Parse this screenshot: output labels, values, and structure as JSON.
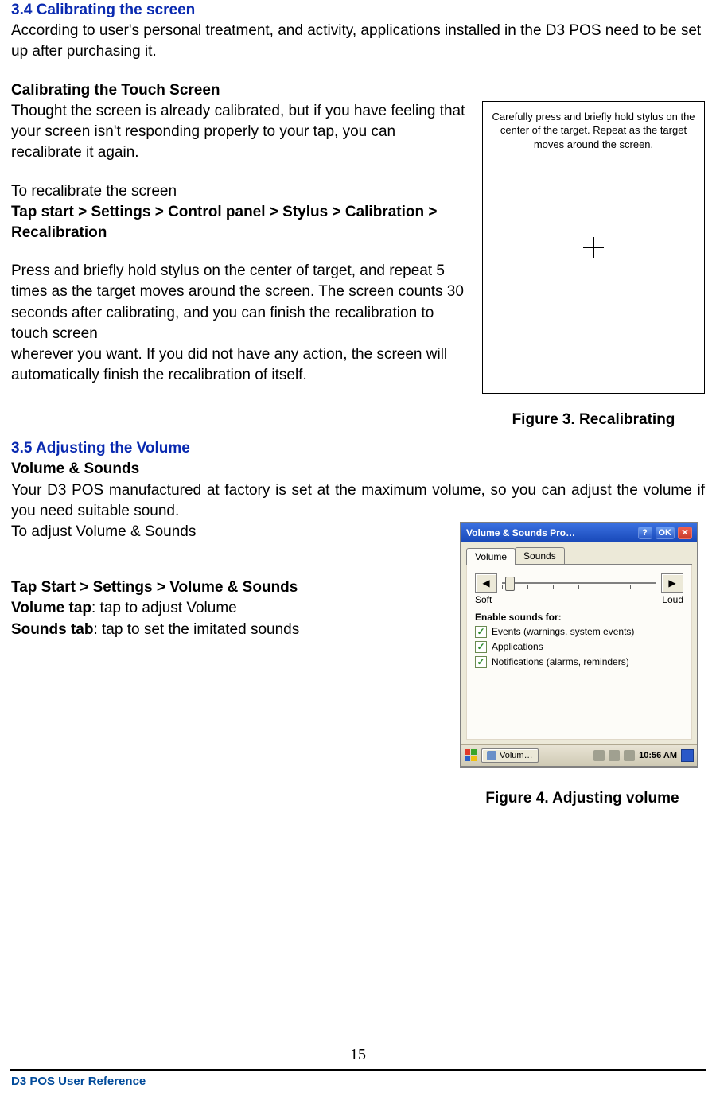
{
  "h34": "3.4 Calibrating the screen",
  "p34": "According to user's personal treatment, and activity, applications installed in the D3 POS need to be set up after purchasing it.",
  "hCal": "Calibrating the Touch Screen",
  "pCal1": "Thought the screen is already calibrated, but if you have feeling that your screen isn't responding properly to your tap, you can recalibrate it again.",
  "pCal2": "To recalibrate the screen",
  "navCal": "Tap start > Settings > Control panel > Stylus > Calibration > Recalibration",
  "pCal3a": "Press and briefly hold stylus on the center of target, and repeat 5 times as the target moves around the screen. The screen counts 30 seconds after calibrating, and you can finish the recalibration to touch screen",
  "pCal3b": "wherever you want. If you did not have any action, the screen will automatically finish the recalibration of itself.",
  "fig3_text": "Carefully press and briefly hold stylus on the center of the target. Repeat as the target moves around the screen.",
  "fig3_cap": "Figure 3. Recalibrating",
  "h35": "3.5 Adjusting the Volume",
  "hVol": "Volume & Sounds",
  "pVol1": "Your D3 POS manufactured at factory is set at the maximum volume, so you can adjust the volume if you need suitable sound.",
  "pVol2": "To adjust Volume & Sounds",
  "navVol": "Tap Start > Settings > Volume & Sounds",
  "volTapLabel": "Volume tap",
  "volTapDesc": ": tap to adjust Volume",
  "sndTabLabel": "Sounds tab",
  "sndTabDesc": ": tap to set the imitated sounds",
  "vs": {
    "title": "Volume & Sounds Pro…",
    "help": "?",
    "ok": "OK",
    "close": "✕",
    "tab_volume": "Volume",
    "tab_sounds": "Sounds",
    "soft": "Soft",
    "loud": "Loud",
    "enable": "Enable sounds for:",
    "chk1": "Events (warnings, system events)",
    "chk2": "Applications",
    "chk3": "Notifications (alarms, reminders)",
    "task_app": "Volum…",
    "clock": "10:56 AM"
  },
  "fig4_cap": "Figure 4. Adjusting volume",
  "page_no": "15",
  "footer": "D3 POS User Reference"
}
